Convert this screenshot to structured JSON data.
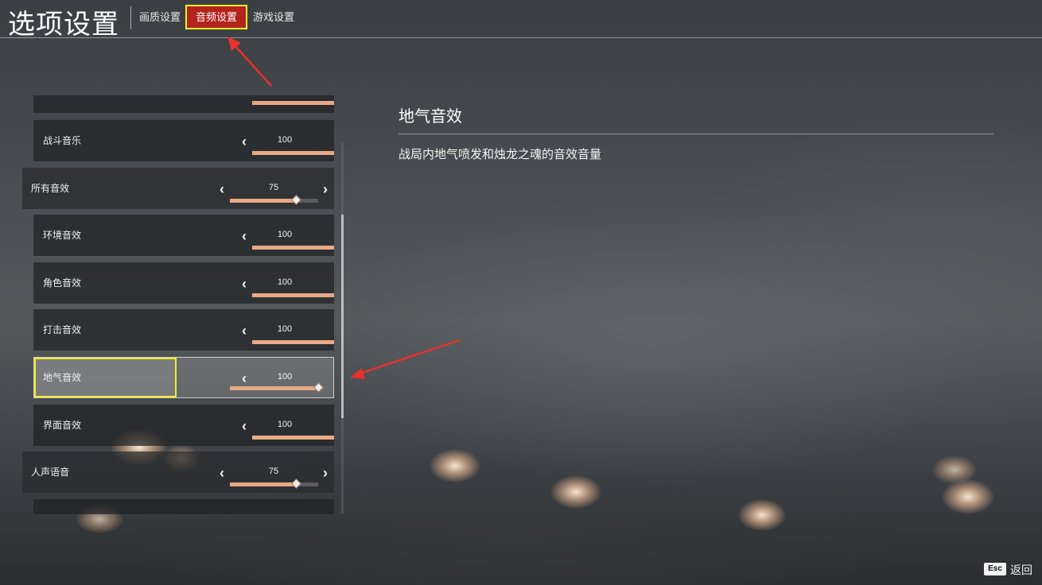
{
  "header": {
    "title": "选项设置",
    "tabs": [
      {
        "label": "画质设置",
        "active": false
      },
      {
        "label": "音频设置",
        "active": true
      },
      {
        "label": "游戏设置",
        "active": false
      }
    ]
  },
  "settings": {
    "rows": [
      {
        "label": "战斗音乐",
        "value": "100",
        "fraction": 1.0
      },
      {
        "label": "所有音效",
        "value": "75",
        "fraction": 0.75
      },
      {
        "label": "环境音效",
        "value": "100",
        "fraction": 1.0
      },
      {
        "label": "角色音效",
        "value": "100",
        "fraction": 1.0
      },
      {
        "label": "打击音效",
        "value": "100",
        "fraction": 1.0
      },
      {
        "label": "地气音效",
        "value": "100",
        "fraction": 1.0
      },
      {
        "label": "界面音效",
        "value": "100",
        "fraction": 1.0
      },
      {
        "label": "人声语音",
        "value": "75",
        "fraction": 0.75
      }
    ],
    "partial_top_fraction": 1.0
  },
  "description": {
    "title": "地气音效",
    "text": "战局内地气喷发和烛龙之魂的音效音量"
  },
  "footer": {
    "esc_key": "Esc",
    "back_label": "返回"
  },
  "colors": {
    "slider_fill": "#e8a985",
    "active_tab": "#b1231c",
    "highlight_border": "#f2ee2b",
    "annotation_arrow": "#e8322c"
  }
}
